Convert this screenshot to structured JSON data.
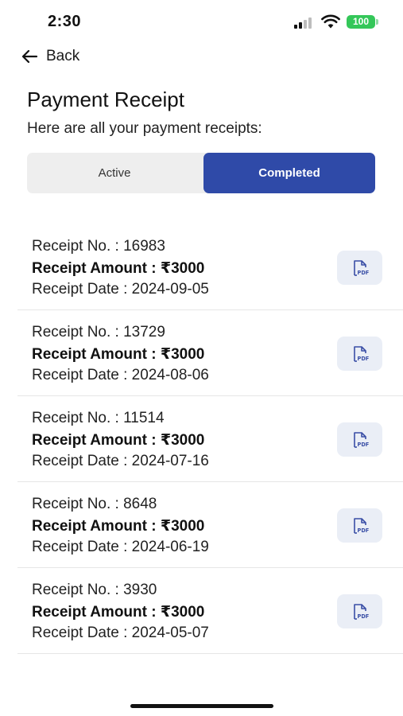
{
  "status_bar": {
    "time": "2:30",
    "battery": "100"
  },
  "nav": {
    "back_label": "Back"
  },
  "header": {
    "title": "Payment Receipt",
    "subtitle": "Here are all your payment receipts:"
  },
  "tabs": [
    {
      "label": "Active",
      "selected": false
    },
    {
      "label": "Completed",
      "selected": true
    }
  ],
  "receipts": [
    {
      "number": "Receipt No. : 16983",
      "amount": "Receipt Amount : ₹3000",
      "date": "Receipt Date : 2024-09-05"
    },
    {
      "number": "Receipt No. : 13729",
      "amount": "Receipt Amount : ₹3000",
      "date": "Receipt Date : 2024-08-06"
    },
    {
      "number": "Receipt No. : 11514",
      "amount": "Receipt Amount : ₹3000",
      "date": "Receipt Date : 2024-07-16"
    },
    {
      "number": "Receipt No. : 8648",
      "amount": "Receipt Amount : ₹3000",
      "date": "Receipt Date : 2024-06-19"
    },
    {
      "number": "Receipt No. : 3930",
      "amount": "Receipt Amount : ₹3000",
      "date": "Receipt Date : 2024-05-07"
    }
  ],
  "icons": {
    "back": "arrow-left-icon",
    "download": "pdf-file-icon"
  },
  "colors": {
    "accent": "#2f4aa8",
    "battery": "#34c759",
    "pdf_button_bg": "#eaeef6"
  }
}
